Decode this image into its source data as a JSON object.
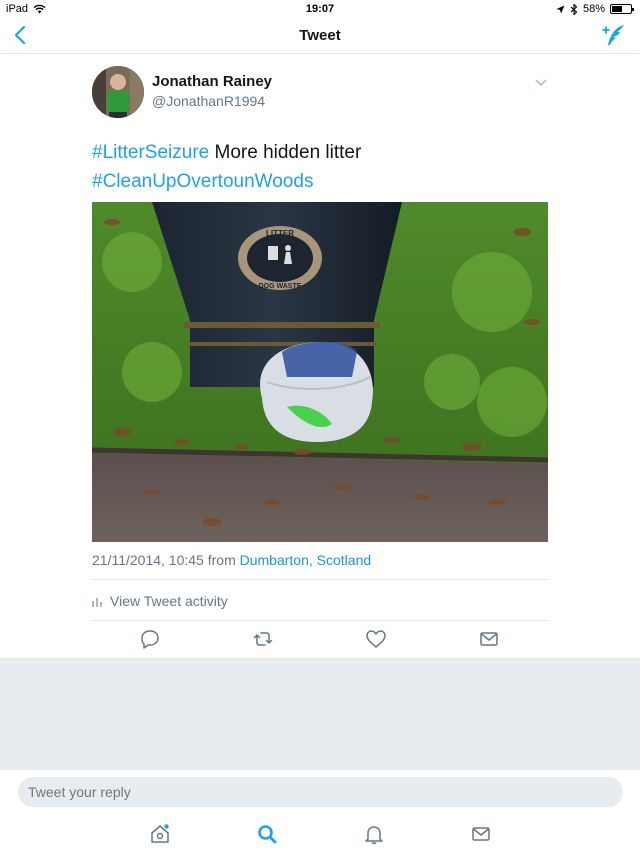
{
  "status_bar": {
    "device": "iPad",
    "time": "19:07",
    "battery": "58%",
    "battery_level": 0.58
  },
  "nav": {
    "title": "Tweet",
    "icons": {
      "back": "chevron-left-icon",
      "compose": "compose-tweet-icon"
    }
  },
  "tweet": {
    "author_name": "Jonathan Rainey",
    "author_handle": "@JonathanR1994",
    "text_hashtag_1": "#LitterSeizure",
    "text_body": " More hidden litter",
    "text_hashtag_2": "#CleanUpOvertounWoods",
    "photo_sign_top": "LITTER",
    "photo_sign_bottom": "DOG WASTE",
    "timestamp": "21/11/2014, 10:45 from ",
    "location": "Dumbarton, Scotland",
    "activity_label": "View Tweet activity"
  },
  "reply": {
    "placeholder": "Tweet your reply"
  },
  "colors": {
    "accent": "#1da1f2",
    "secondary_text": "#657786",
    "background_gray": "#e6ecf0"
  }
}
